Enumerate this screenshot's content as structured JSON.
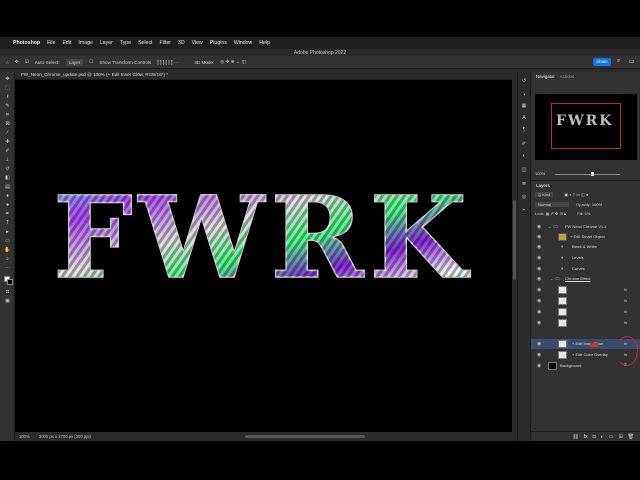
{
  "menubar": {
    "apple": "",
    "app": "Photoshop",
    "items": [
      "File",
      "Edit",
      "Image",
      "Layer",
      "Type",
      "Select",
      "Filter",
      "3D",
      "View",
      "Plugins",
      "Window",
      "Help"
    ]
  },
  "window_title": "Adobe Photoshop 2022",
  "options_bar": {
    "auto_select_label": "Auto-Select:",
    "auto_select_value": "Layer",
    "transform_label": "Show Transform Controls",
    "mode_label": "3D Mode:",
    "share_label": "Share"
  },
  "document_tab": "FW_Neon_Chrome_update.psd @ 100% (+ Edit Inner Glow, RGB/16*) *",
  "canvas": {
    "text": "FWRK"
  },
  "status_bar": {
    "zoom": "100%",
    "dims": "3000 px x 2700 px (300 ppi)"
  },
  "panel_tabs": {
    "navigator": "Navigator",
    "actions": "Actions"
  },
  "navigator": {
    "preview_text": "FWRK",
    "zoom": "100%"
  },
  "layers_panel": {
    "title": "Layers",
    "kind_label": "Q Kind",
    "blend_mode": "Normal",
    "opacity_label": "Opacity:",
    "opacity_value": "100%",
    "lock_label": "Lock:",
    "fill_label": "Fill:",
    "fill_value": "0%",
    "layers": [
      {
        "name": "FW Neon Chrome V1.1",
        "type": "group"
      },
      {
        "name": "+ Edit Smart Object",
        "type": "smart"
      },
      {
        "name": "Black & White",
        "type": "adjustment"
      },
      {
        "name": "Levels",
        "type": "adjustment"
      },
      {
        "name": "Curves",
        "type": "adjustment"
      },
      {
        "name": "Chrome Effect",
        "type": "group"
      },
      {
        "name": "",
        "type": "layer"
      },
      {
        "name": "",
        "type": "layer"
      },
      {
        "name": "",
        "type": "layer"
      },
      {
        "name": "",
        "type": "layer"
      },
      {
        "name": "+ Edit Inner Glow",
        "type": "layer"
      },
      {
        "name": "+ Edit Color Overlay",
        "type": "layer"
      },
      {
        "name": "Background",
        "type": "background"
      }
    ],
    "fx_label": "fx"
  },
  "colors": {
    "accent": "#1473e6",
    "selection": "#3b4c6b",
    "annotation_red": "#c62828",
    "canvas_bg": "#000000"
  }
}
